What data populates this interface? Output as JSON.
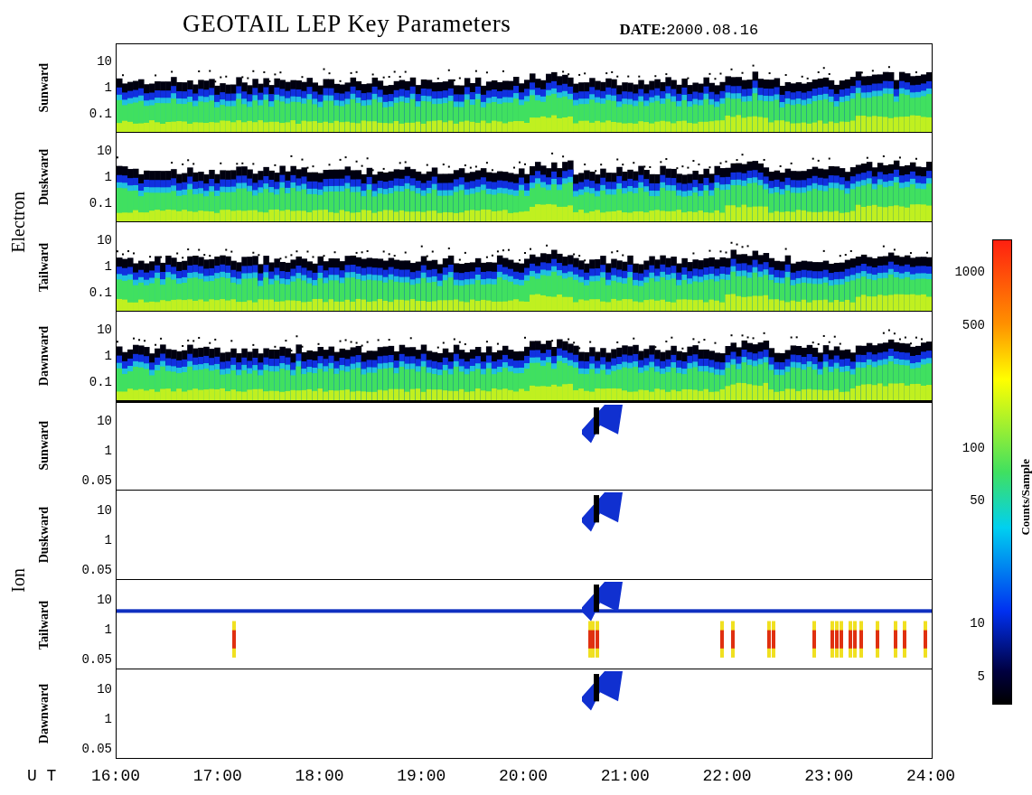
{
  "title": "GEOTAIL LEP Key Parameters",
  "date_label": "DATE:",
  "date": "2000.08.16",
  "groups": [
    {
      "label": "Electron",
      "kind": "electron",
      "panels": [
        {
          "label": "Sunward",
          "yticks": [
            "10",
            "1",
            "0.1"
          ]
        },
        {
          "label": "Duskward",
          "yticks": [
            "10",
            "1",
            "0.1"
          ]
        },
        {
          "label": "Tailward",
          "yticks": [
            "10",
            "1",
            "0.1"
          ]
        },
        {
          "label": "Dawnward",
          "yticks": [
            "10",
            "1",
            "0.1"
          ]
        }
      ]
    },
    {
      "label": "Ion",
      "kind": "ion",
      "panels": [
        {
          "label": "Sunward",
          "yticks": [
            "10",
            "1",
            "0.05"
          ]
        },
        {
          "label": "Duskward",
          "yticks": [
            "10",
            "1",
            "0.05"
          ]
        },
        {
          "label": "Tailward",
          "yticks": [
            "10",
            "1",
            "0.05"
          ]
        },
        {
          "label": "Dawnward",
          "yticks": [
            "10",
            "1",
            "0.05"
          ]
        }
      ]
    }
  ],
  "x_axis": {
    "label": "U T",
    "ticks": [
      "16:00",
      "17:00",
      "18:00",
      "19:00",
      "20:00",
      "21:00",
      "22:00",
      "23:00",
      "24:00"
    ]
  },
  "colorbar": {
    "label": "Counts/Sample",
    "ticks": [
      "1000",
      "500",
      "100",
      "50",
      "10",
      "5"
    ]
  }
}
